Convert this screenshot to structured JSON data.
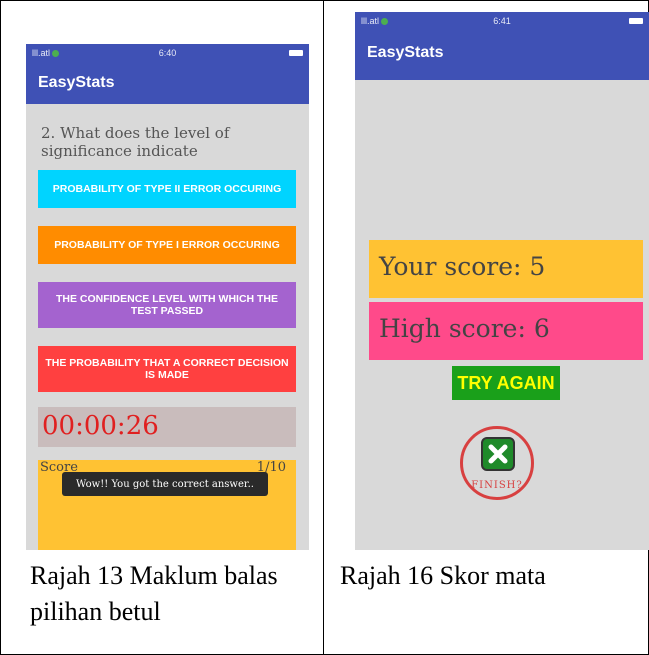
{
  "left_screen": {
    "status": {
      "signal": "lll.atl",
      "time": "6:40"
    },
    "app_title": "EasyStats",
    "question": "2. What does the level of significance indicate",
    "options": [
      {
        "label": "PROBABILITY OF TYPE II ERROR OCCURING",
        "color": "#00d4ff"
      },
      {
        "label": "PROBABILITY OF TYPE I ERROR OCCURING",
        "color": "#ff8c00"
      },
      {
        "label": "THE CONFIDENCE LEVEL WITH WHICH THE TEST PASSED",
        "color": "#a463cf"
      },
      {
        "label": "THE PROBABILITY THAT A CORRECT DECISION IS MADE",
        "color": "#ff4040"
      }
    ],
    "timer": "00:00:26",
    "score_label": "Score",
    "score_value": "1/10",
    "toast": "Wow!! You got the correct answer.."
  },
  "left_caption": "Rajah 13 Maklum balas pilihan betul",
  "right_screen": {
    "status": {
      "signal": "lll.atl",
      "time": "6:41"
    },
    "app_title": "EasyStats",
    "your_score": "Your score: 5",
    "high_score": "High score: 6",
    "try_again": "TRY AGAIN",
    "finish": "FINISH?"
  },
  "right_caption": "Rajah 16 Skor mata"
}
